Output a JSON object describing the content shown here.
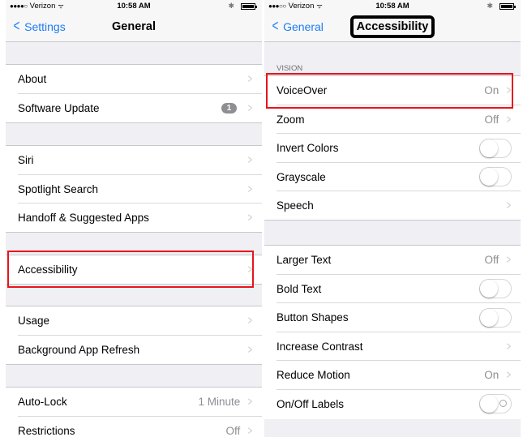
{
  "left": {
    "status": {
      "signal": "●●●●○",
      "carrier": "Verizon",
      "wifi": "ᯤ",
      "time": "10:58 AM",
      "bluetooth": "✱"
    },
    "nav": {
      "back_label": "Settings",
      "title": "General"
    },
    "rows": [
      {
        "label": "About"
      },
      {
        "label": "Software Update",
        "badge": "1"
      },
      {
        "label": "Siri"
      },
      {
        "label": "Spotlight Search"
      },
      {
        "label": "Handoff & Suggested Apps"
      },
      {
        "label": "Accessibility"
      },
      {
        "label": "Usage"
      },
      {
        "label": "Background App Refresh"
      },
      {
        "label": "Auto-Lock",
        "detail": "1 Minute"
      },
      {
        "label": "Restrictions",
        "detail": "Off"
      }
    ]
  },
  "right": {
    "status": {
      "signal": "●●●○○",
      "carrier": "Verizon",
      "wifi": "ᯤ",
      "time": "10:58 AM",
      "bluetooth": "✱"
    },
    "nav": {
      "back_label": "General",
      "title": "Accessibility"
    },
    "section_vision": "VISION",
    "rows": [
      {
        "label": "VoiceOver",
        "detail": "On"
      },
      {
        "label": "Zoom",
        "detail": "Off"
      },
      {
        "label": "Invert Colors",
        "toggle": false
      },
      {
        "label": "Grayscale",
        "toggle": false
      },
      {
        "label": "Speech"
      },
      {
        "label": "Larger Text",
        "detail": "Off"
      },
      {
        "label": "Bold Text",
        "toggle": false
      },
      {
        "label": "Button Shapes",
        "toggle": false
      },
      {
        "label": "Increase Contrast"
      },
      {
        "label": "Reduce Motion",
        "detail": "On"
      },
      {
        "label": "On/Off Labels",
        "toggle": false
      }
    ]
  },
  "colors": {
    "accent": "#1d7cf2",
    "highlight": "#e8141c",
    "background": "#efeff4"
  },
  "icons": {
    "back": "chevron-left-icon",
    "row": "chevron-right-icon"
  }
}
